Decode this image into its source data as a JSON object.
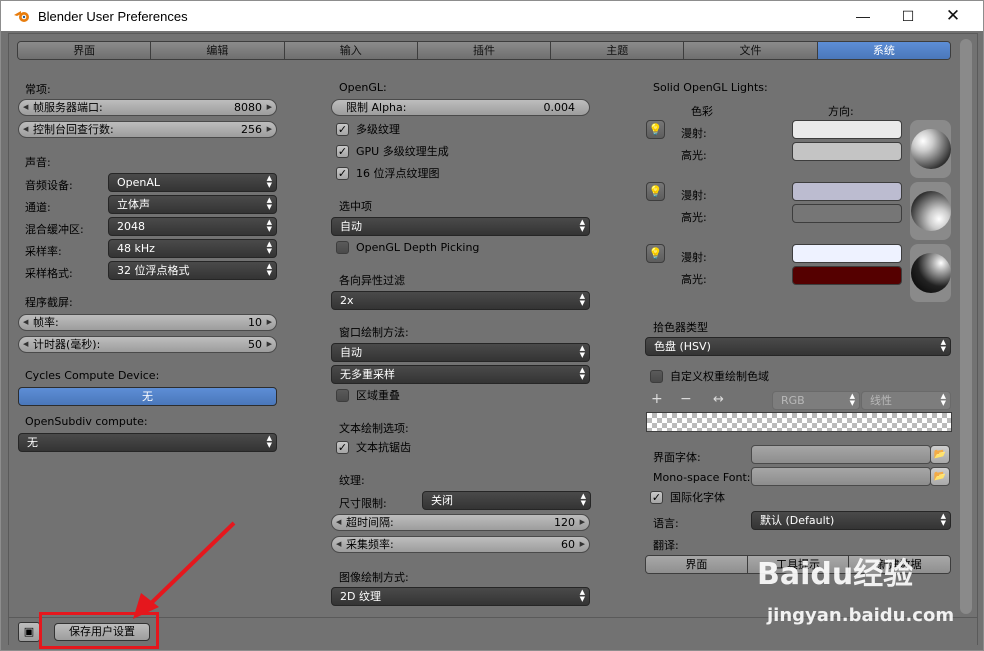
{
  "window": {
    "title": "Blender User Preferences"
  },
  "tabs": [
    "界面",
    "编辑",
    "输入",
    "插件",
    "主题",
    "文件",
    "系统"
  ],
  "left": {
    "general_hdr": "常项:",
    "frame_server_port": {
      "label": "帧服务器端口:",
      "value": "8080"
    },
    "console_scrollback": {
      "label": "控制台回查行数:",
      "value": "256"
    },
    "sound_hdr": "声音:",
    "audio_device": {
      "label": "音频设备:",
      "value": "OpenAL"
    },
    "channels": {
      "label": "通道:",
      "value": "立体声"
    },
    "mix_buffer": {
      "label": "混合缓冲区:",
      "value": "2048"
    },
    "sample_rate": {
      "label": "采样率:",
      "value": "48 kHz"
    },
    "sample_format": {
      "label": "采样格式:",
      "value": "32 位浮点格式"
    },
    "screencast_hdr": "程序截屏:",
    "fps": {
      "label": "帧率:",
      "value": "10"
    },
    "wait_timer": {
      "label": "计时器(毫秒):",
      "value": "50"
    },
    "cycles_hdr": "Cycles Compute Device:",
    "cycles_value": "无",
    "opensubdiv_hdr": "OpenSubdiv compute:",
    "opensubdiv_value": "无"
  },
  "middle": {
    "opengl_hdr": "OpenGL:",
    "clip_alpha": {
      "label": "限制 Alpha:",
      "value": "0.004"
    },
    "mipmaps": "多级纹理",
    "gpu_mipmap": "GPU 多级纹理生成",
    "float_textures": "16 位浮点纹理图",
    "selection_hdr": "选中项",
    "selection_value": "自动",
    "depth_picking": "OpenGL Depth Picking",
    "anisotropic_hdr": "各向异性过滤",
    "anisotropic_value": "2x",
    "window_draw_hdr": "窗口绘制方法:",
    "window_draw_value": "自动",
    "multisample_value": "无多重采样",
    "region_overlap": "区域重叠",
    "text_draw_hdr": "文本绘制选项:",
    "text_antialias": "文本抗锯齿",
    "textures_hdr": "纹理:",
    "size_limit": {
      "label": "尺寸限制:",
      "value": "关闭"
    },
    "timeout": {
      "label": "超时间隔:",
      "value": "120"
    },
    "collection_rate": {
      "label": "采集频率:",
      "value": "60"
    },
    "image_draw_hdr": "图像绘制方式:",
    "image_draw_value": "2D 纹理"
  },
  "right": {
    "solid_lights_hdr": "Solid OpenGL Lights:",
    "color_hdr": "色彩",
    "direction_hdr": "方向:",
    "diffuse": "漫射:",
    "specular": "高光:",
    "lights": [
      {
        "diffuse": "#eaeaea",
        "specular": "#c4c4c4"
      },
      {
        "diffuse": "#bcbcd0",
        "specular": "#767676"
      },
      {
        "diffuse": "#eef2ff",
        "specular": "#550000"
      }
    ],
    "picker_hdr": "拾色器类型",
    "picker_value": "色盘 (HSV)",
    "custom_weight": "自定义权重绘制色域",
    "plus": "+",
    "minus": "−",
    "flip": "↔",
    "rgb": "RGB",
    "linear": "线性",
    "interface_font": "界面字体:",
    "mono_font": "Mono-space Font:",
    "intl_fonts": "国际化字体",
    "language": {
      "label": "语言:",
      "value": "默认 (Default)"
    },
    "translate_hdr": "翻译:",
    "translate_buttons": [
      "界面",
      "工具提示",
      "新建数据"
    ]
  },
  "footer": {
    "save": "保存用户设置"
  },
  "watermark": {
    "brand": "Baidu经验",
    "url": "jingyan.baidu.com"
  }
}
